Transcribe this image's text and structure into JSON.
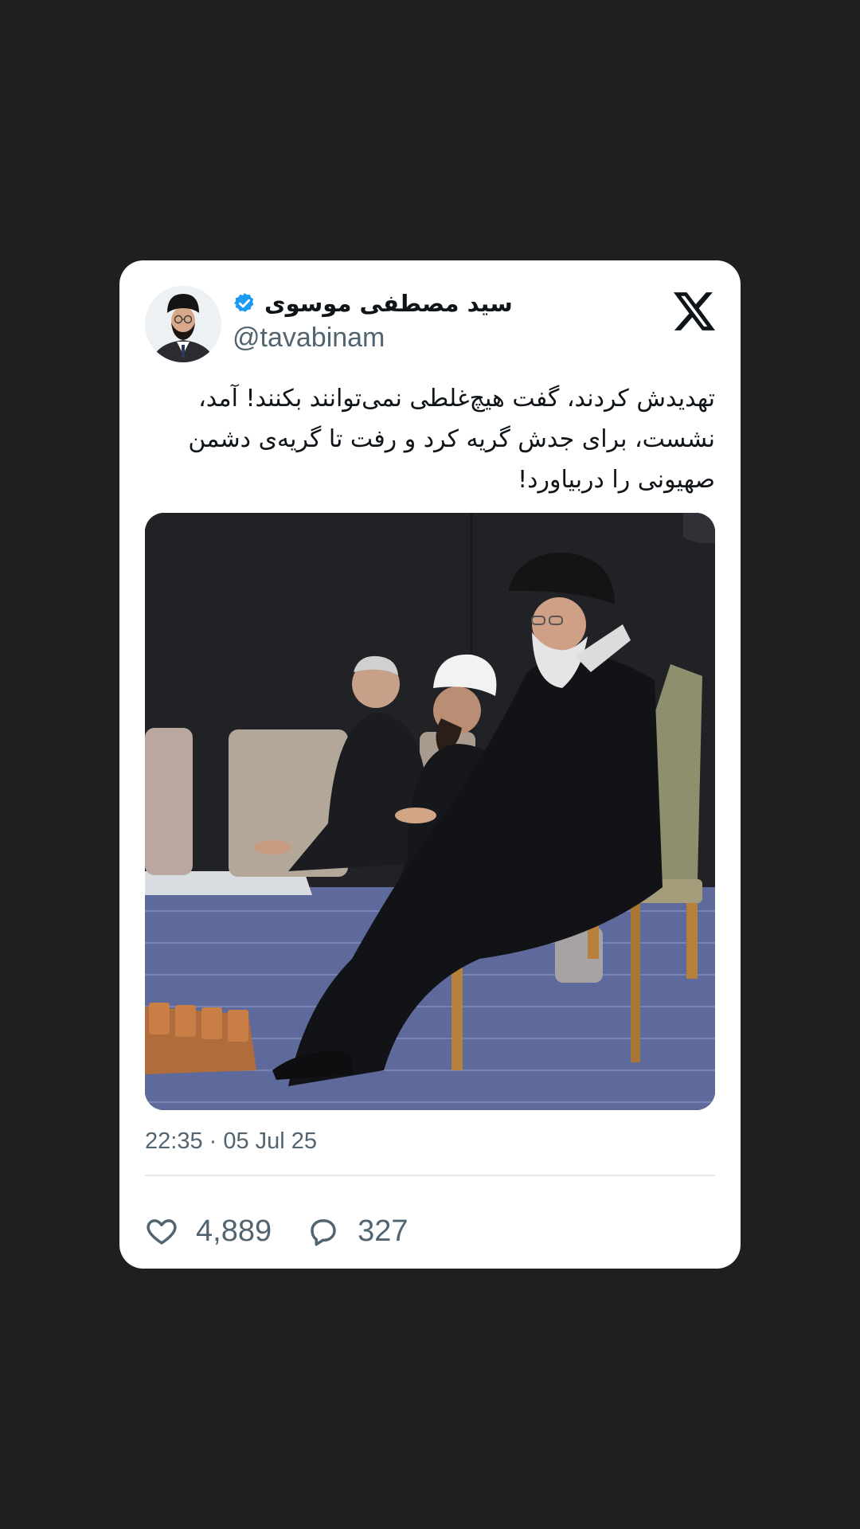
{
  "author": {
    "name": "سید مصطفی موسوی",
    "handle": "@tavabinam",
    "verified": true
  },
  "tweet": {
    "text": "تهدیدش کردند، گفت هیچ‌غلطی نمی‌توانند بکنند! آمد، نشست، برای جدش گریه کرد و رفت تا گریه‌ی دشمن صهیونی را دربیاورد!",
    "timestamp": "22:35 · 05 Jul 25"
  },
  "stats": {
    "likes": "4,889",
    "replies": "327"
  },
  "icons": {
    "brand": "x-logo-icon",
    "verified": "verified-badge-icon",
    "like": "heart-icon",
    "reply": "speech-bubble-icon"
  },
  "colors": {
    "background": "#1f1f1f",
    "card": "#ffffff",
    "text": "#0f1419",
    "muted": "#536471",
    "verified": "#1d9bf0"
  }
}
